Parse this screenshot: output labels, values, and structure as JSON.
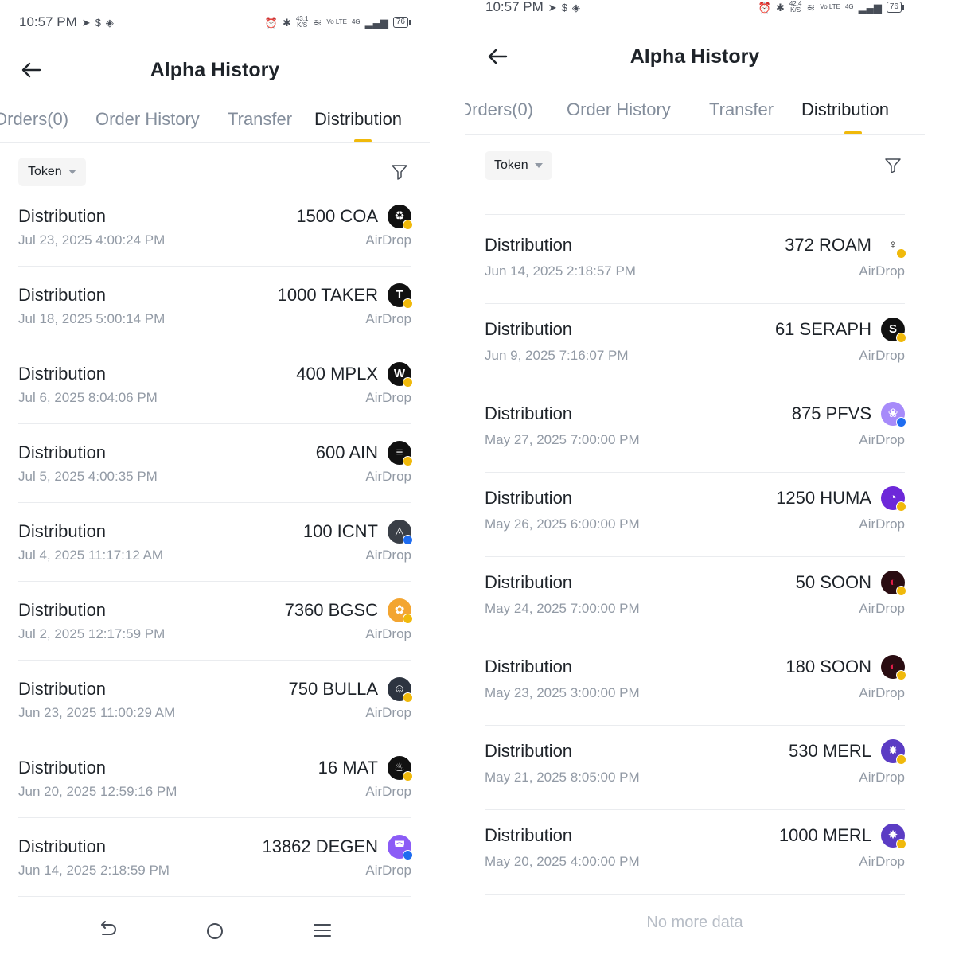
{
  "colors": {
    "accent": "#f0b90b",
    "text_primary": "#1e2329",
    "text_secondary": "#929aa5",
    "tab_inactive": "#848e9c",
    "divider": "#eaecef"
  },
  "left": {
    "status": {
      "time": "10:57 PM",
      "net_speed_value": "43.1",
      "net_speed_unit": "K/S",
      "network": "4G",
      "lte": "Vo LTE",
      "battery": "76"
    },
    "header": {
      "title": "Alpha History"
    },
    "tabs": [
      {
        "label": "Orders(0)"
      },
      {
        "label": "Order History"
      },
      {
        "label": "Transfer"
      },
      {
        "label": "Distribution",
        "active": true
      }
    ],
    "filter": {
      "token_label": "Token"
    },
    "rows": [
      {
        "title": "Distribution",
        "date": "Jul 23, 2025 4:00:24 PM",
        "amount": "1500 COA",
        "type": "AirDrop",
        "icon": "coa-coin-icon",
        "color": "#111111",
        "glyph": "♻"
      },
      {
        "title": "Distribution",
        "date": "Jul 18, 2025 5:00:14 PM",
        "amount": "1000 TAKER",
        "type": "AirDrop",
        "icon": "taker-coin-icon",
        "color": "#111111",
        "glyph": "T"
      },
      {
        "title": "Distribution",
        "date": "Jul 6, 2025 8:04:06 PM",
        "amount": "400 MPLX",
        "type": "AirDrop",
        "icon": "mplx-coin-icon",
        "color": "#111111",
        "glyph": "W"
      },
      {
        "title": "Distribution",
        "date": "Jul 5, 2025 4:00:35 PM",
        "amount": "600 AIN",
        "type": "AirDrop",
        "icon": "ain-coin-icon",
        "color": "#111111",
        "glyph": "≡"
      },
      {
        "title": "Distribution",
        "date": "Jul 4, 2025 11:17:12 AM",
        "amount": "100 ICNT",
        "type": "AirDrop",
        "icon": "icnt-coin-icon",
        "color": "#3a3f47",
        "glyph": "◬",
        "badge": "blue"
      },
      {
        "title": "Distribution",
        "date": "Jul 2, 2025 12:17:59 PM",
        "amount": "7360 BGSC",
        "type": "AirDrop",
        "icon": "bgsc-coin-icon",
        "color": "#f3a531",
        "glyph": "✿"
      },
      {
        "title": "Distribution",
        "date": "Jun 23, 2025 11:00:29 AM",
        "amount": "750 BULLA",
        "type": "AirDrop",
        "icon": "bulla-coin-icon",
        "color": "#2d3440",
        "glyph": "☺"
      },
      {
        "title": "Distribution",
        "date": "Jun 20, 2025 12:59:16 PM",
        "amount": "16 MAT",
        "type": "AirDrop",
        "icon": "mat-coin-icon",
        "color": "#111111",
        "glyph": "♨"
      },
      {
        "title": "Distribution",
        "date": "Jun 14, 2025 2:18:59 PM",
        "amount": "13862 DEGEN",
        "type": "AirDrop",
        "icon": "degen-coin-icon",
        "color": "#8b5cf6",
        "glyph": "◚",
        "badge": "blue"
      }
    ]
  },
  "right": {
    "status": {
      "time": "10:57 PM",
      "net_speed_value": "42.4",
      "net_speed_unit": "K/S",
      "network": "4G",
      "lte": "Vo LTE",
      "battery": "76"
    },
    "header": {
      "title": "Alpha History"
    },
    "tabs": [
      {
        "label": "Orders(0)"
      },
      {
        "label": "Order History"
      },
      {
        "label": "Transfer"
      },
      {
        "label": "Distribution",
        "active": true
      }
    ],
    "filter": {
      "token_label": "Token"
    },
    "rows": [
      {
        "title": "Distribution",
        "date": "Jun 14, 2025 2:18:57 PM",
        "amount": "372 ROAM",
        "type": "AirDrop",
        "icon": "roam-coin-icon",
        "color": "#ffffff",
        "glyph": "♀",
        "glyph_color": "#111111"
      },
      {
        "title": "Distribution",
        "date": "Jun 9, 2025 7:16:07 PM",
        "amount": "61 SERAPH",
        "type": "AirDrop",
        "icon": "seraph-coin-icon",
        "color": "#111111",
        "glyph": "S"
      },
      {
        "title": "Distribution",
        "date": "May 27, 2025 7:00:00 PM",
        "amount": "875 PFVS",
        "type": "AirDrop",
        "icon": "pfvs-coin-icon",
        "color": "#a78bfa",
        "glyph": "❀",
        "badge": "blue"
      },
      {
        "title": "Distribution",
        "date": "May 26, 2025 6:00:00 PM",
        "amount": "1250 HUMA",
        "type": "AirDrop",
        "icon": "huma-coin-icon",
        "color": "#6d28d9",
        "glyph": "◔"
      },
      {
        "title": "Distribution",
        "date": "May 24, 2025 7:00:00 PM",
        "amount": "50 SOON",
        "type": "AirDrop",
        "icon": "soon-coin-icon",
        "color": "#2a0d12",
        "glyph": "◐",
        "glyph_color": "#e11d48"
      },
      {
        "title": "Distribution",
        "date": "May 23, 2025 3:00:00 PM",
        "amount": "180 SOON",
        "type": "AirDrop",
        "icon": "soon-coin-icon",
        "color": "#2a0d12",
        "glyph": "◐",
        "glyph_color": "#e11d48"
      },
      {
        "title": "Distribution",
        "date": "May 21, 2025 8:05:00 PM",
        "amount": "530 MERL",
        "type": "AirDrop",
        "icon": "merl-coin-icon",
        "color": "#5b3cc4",
        "glyph": "✸"
      },
      {
        "title": "Distribution",
        "date": "May 20, 2025 4:00:00 PM",
        "amount": "1000 MERL",
        "type": "AirDrop",
        "icon": "merl-coin-icon",
        "color": "#5b3cc4",
        "glyph": "✸"
      }
    ],
    "footer": {
      "no_more": "No more data"
    }
  }
}
